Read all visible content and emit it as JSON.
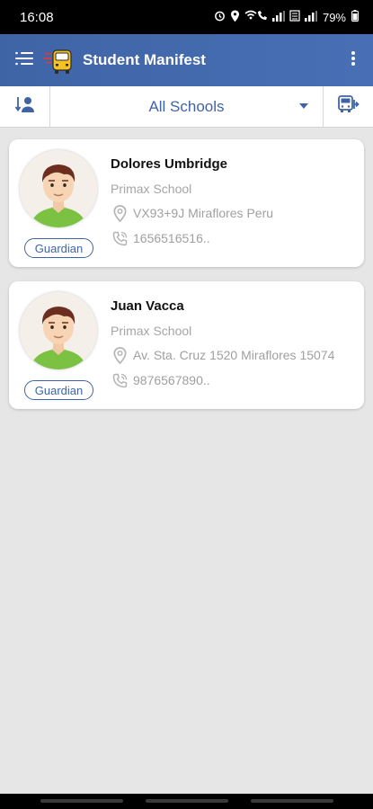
{
  "status_bar": {
    "time": "16:08",
    "battery": "79%"
  },
  "app_bar": {
    "title": "Student Manifest"
  },
  "filter": {
    "selected_school": "All Schools"
  },
  "students": [
    {
      "name": "Dolores Umbridge",
      "school": "Primax School",
      "address": "VX93+9J Miraflores  Peru",
      "phone": "1656516516..",
      "badge": "Guardian"
    },
    {
      "name": "Juan Vacca",
      "school": "Primax School",
      "address": "Av. Sta. Cruz 1520  Miraflores 15074",
      "phone": "9876567890..",
      "badge": "Guardian"
    }
  ],
  "colors": {
    "primary": "#3f64a6",
    "background": "#e6e6e6",
    "avatar_shirt": "#7cc242",
    "avatar_hair": "#6b2e1f"
  },
  "icons": [
    "menu-icon",
    "school-bus-logo-icon",
    "more-vert-icon",
    "user-sort-icon",
    "dropdown-arrow-icon",
    "bus-route-icon",
    "location-pin-icon",
    "phone-icon"
  ]
}
